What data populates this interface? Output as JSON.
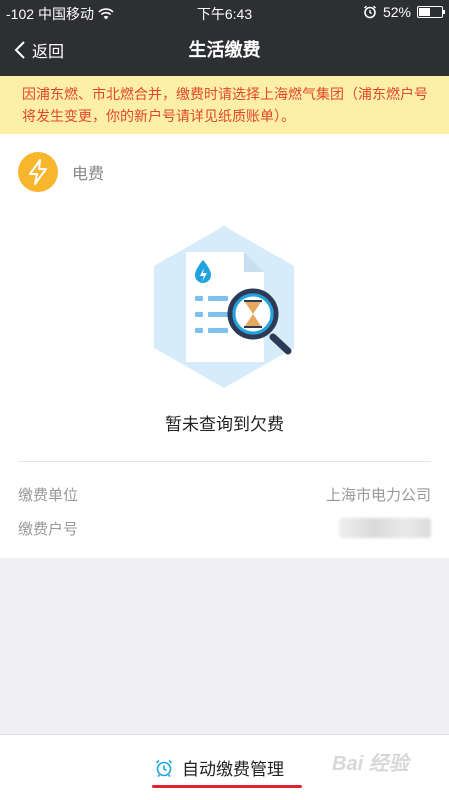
{
  "status_bar": {
    "signal": "-102",
    "carrier": "中国移动",
    "time": "下午6:43",
    "battery": "52%",
    "battery_level": 0.52
  },
  "nav": {
    "back_label": "返回",
    "title": "生活缴费"
  },
  "notice": {
    "text": "因浦东燃、市北燃合并，缴费时请选择上海燃气集团（浦东燃户号将发生变更，你的新户号请详见纸质账单）。"
  },
  "bill": {
    "type": "电费",
    "empty_message": "暂未查询到欠费",
    "rows": [
      {
        "label": "缴费单位",
        "value": "上海市电力公司"
      },
      {
        "label": "缴费户号",
        "value": ""
      }
    ]
  },
  "footer": {
    "auto_pay_label": "自动缴费管理",
    "watermark": "Bai 经验"
  },
  "colors": {
    "header_bg": "#2e2f33",
    "notice_bg": "#fdf0a6",
    "notice_text": "#e2472c",
    "bolt_icon_bg": "#f8b62c",
    "accent_blue": "#1fa3e0",
    "underline_red": "#e3242b"
  }
}
